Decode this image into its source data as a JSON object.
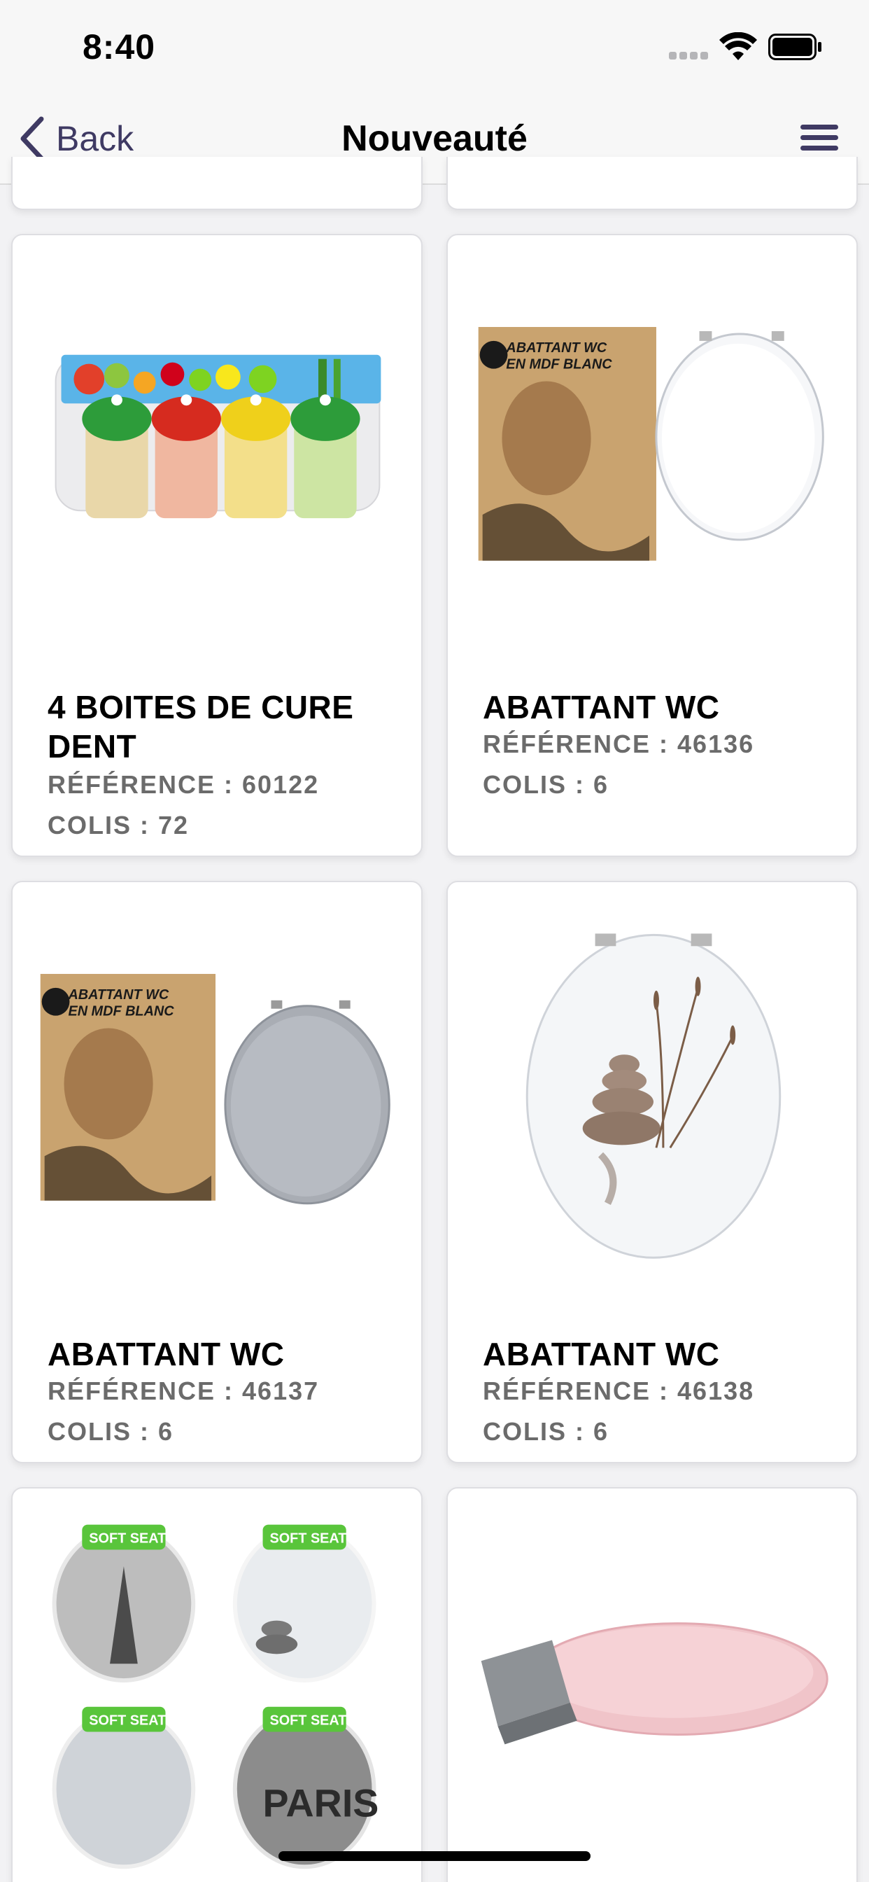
{
  "status_bar": {
    "time": "8:40"
  },
  "nav": {
    "back_label": "Back",
    "title": "Nouveauté",
    "accent_color": "#3f3a63"
  },
  "icons": {
    "back": "chevron-left-icon",
    "menu": "hamburger-menu-icon",
    "wifi": "wifi-icon",
    "battery": "battery-icon",
    "signal": "signal-icon"
  },
  "products": [
    {
      "title": "4 BOITES DE CURE DENT",
      "reference": "RÉFÉRENCE : 60122",
      "colis": "COLIS : 72",
      "image": "four toothpick containers in bamboo pick pack"
    },
    {
      "title": "ABATTANT WC",
      "reference": "RÉFÉRENCE : 46136",
      "colis": "COLIS : 6",
      "image": "white MDF toilet seat with box"
    },
    {
      "title": "ABATTANT WC",
      "reference": "RÉFÉRENCE : 46137",
      "colis": "COLIS : 6",
      "image": "grey MDF toilet seat with box"
    },
    {
      "title": "ABATTANT WC",
      "reference": "RÉFÉRENCE : 46138",
      "colis": "COLIS : 6",
      "image": "white toilet seat with zen stones print"
    },
    {
      "title": "",
      "reference": "",
      "colis": "",
      "image": "four soft seat toilet seats (Paris prints)"
    },
    {
      "title": "",
      "reference": "",
      "colis": "",
      "image": "pink toilet seat with grey box"
    }
  ],
  "image_texts": {
    "abattant_box_line1": "ABATTANT WC",
    "abattant_box_line2": "EN MDF BLANC",
    "soft_seat_label": "SOFT SEAT",
    "paris_print": "PARIS"
  }
}
